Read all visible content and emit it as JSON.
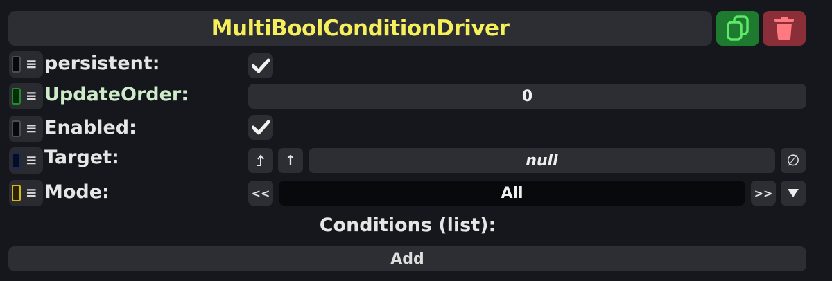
{
  "component": {
    "title": "MultiBoolConditionDriver",
    "duplicate_icon": "duplicate-icon",
    "delete_icon": "trash-icon",
    "title_color": "#f5ef5c"
  },
  "fields": {
    "persistent": {
      "label": "persistent:",
      "checked": true,
      "swatch_color": "#08080a"
    },
    "update_order": {
      "label": "UpdateOrder:",
      "value": "0",
      "swatch_color": "#1f8f2a"
    },
    "enabled": {
      "label": "Enabled:",
      "checked": true,
      "swatch_color": "#08080a"
    },
    "target": {
      "label": "Target:",
      "value": "null",
      "jump_icon": "jump-up-icon",
      "up_icon": "arrow-up-icon",
      "clear_icon": "null-set-icon",
      "swatch_color": "#0c1a3a"
    },
    "mode": {
      "label": "Mode:",
      "value": "All",
      "prev_label": "<<",
      "next_label": ">>",
      "dropdown_icon": "triangle-down-icon",
      "swatch_color": "#d8b81a"
    }
  },
  "conditions": {
    "title": "Conditions (list):",
    "add_label": "Add"
  }
}
